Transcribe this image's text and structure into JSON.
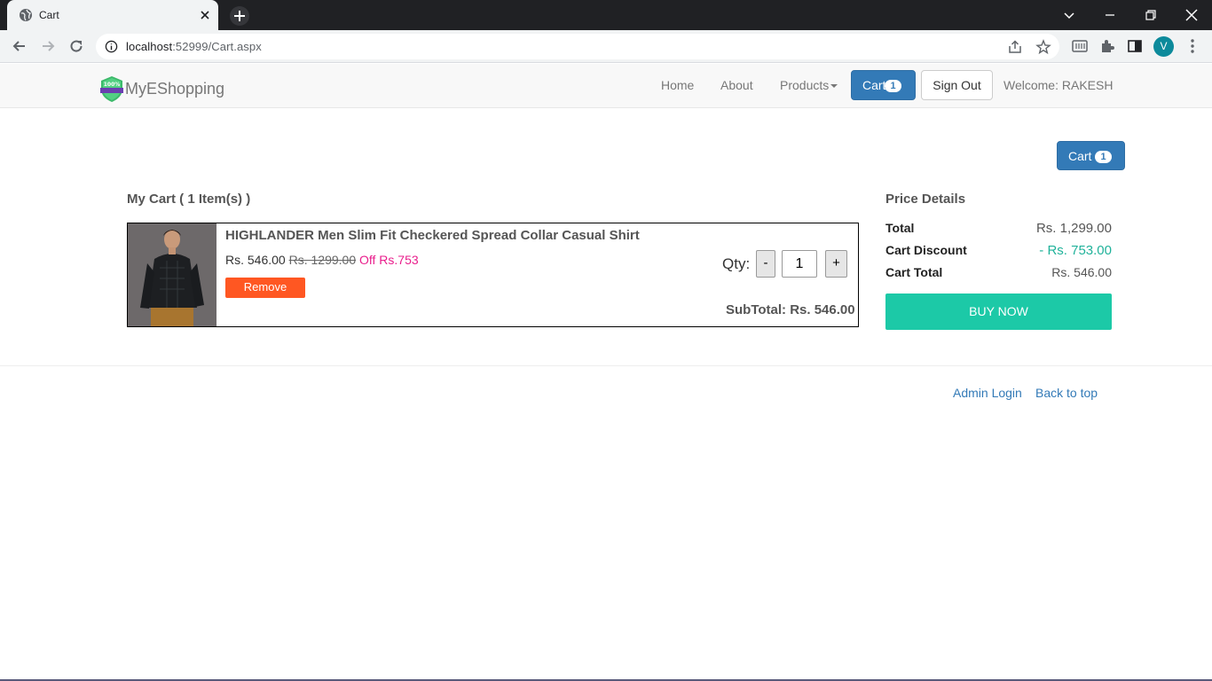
{
  "browser": {
    "tab_title": "Cart",
    "url_host": "localhost",
    "url_rest": ":52999/Cart.aspx",
    "profile_initial": "V"
  },
  "navbar": {
    "brand": "MyEShopping",
    "logo_text": "100%",
    "home": "Home",
    "about": "About",
    "products": "Products",
    "cart_label": "Cart",
    "cart_count": "1",
    "sign_out": "Sign Out",
    "welcome": "Welcome: RAKESH"
  },
  "cart_button": {
    "label": "Cart",
    "count": "1"
  },
  "cart": {
    "title": "My Cart ( 1 Item(s) )",
    "item": {
      "name": "HIGHLANDER Men Slim Fit Checkered Spread Collar Casual Shirt",
      "price": "Rs.  546.00",
      "mrp": "Rs.  1299.00",
      "off": "Off Rs.753",
      "remove": "Remove",
      "qty_label": "Qty:",
      "minus": "-",
      "qty": "1",
      "plus": "+",
      "subtotal": "SubTotal: Rs.  546.00"
    }
  },
  "price_details": {
    "title": "Price Details",
    "total_label": "Total",
    "total_value": "Rs. 1,299.00",
    "discount_label": "Cart Discount",
    "discount_value": "- Rs. 753.00",
    "cart_total_label": "Cart Total",
    "cart_total_value": "Rs. 546.00",
    "buy_now": "BUY NOW"
  },
  "footer": {
    "admin_login": "Admin Login",
    "back_to_top": "Back to top"
  }
}
